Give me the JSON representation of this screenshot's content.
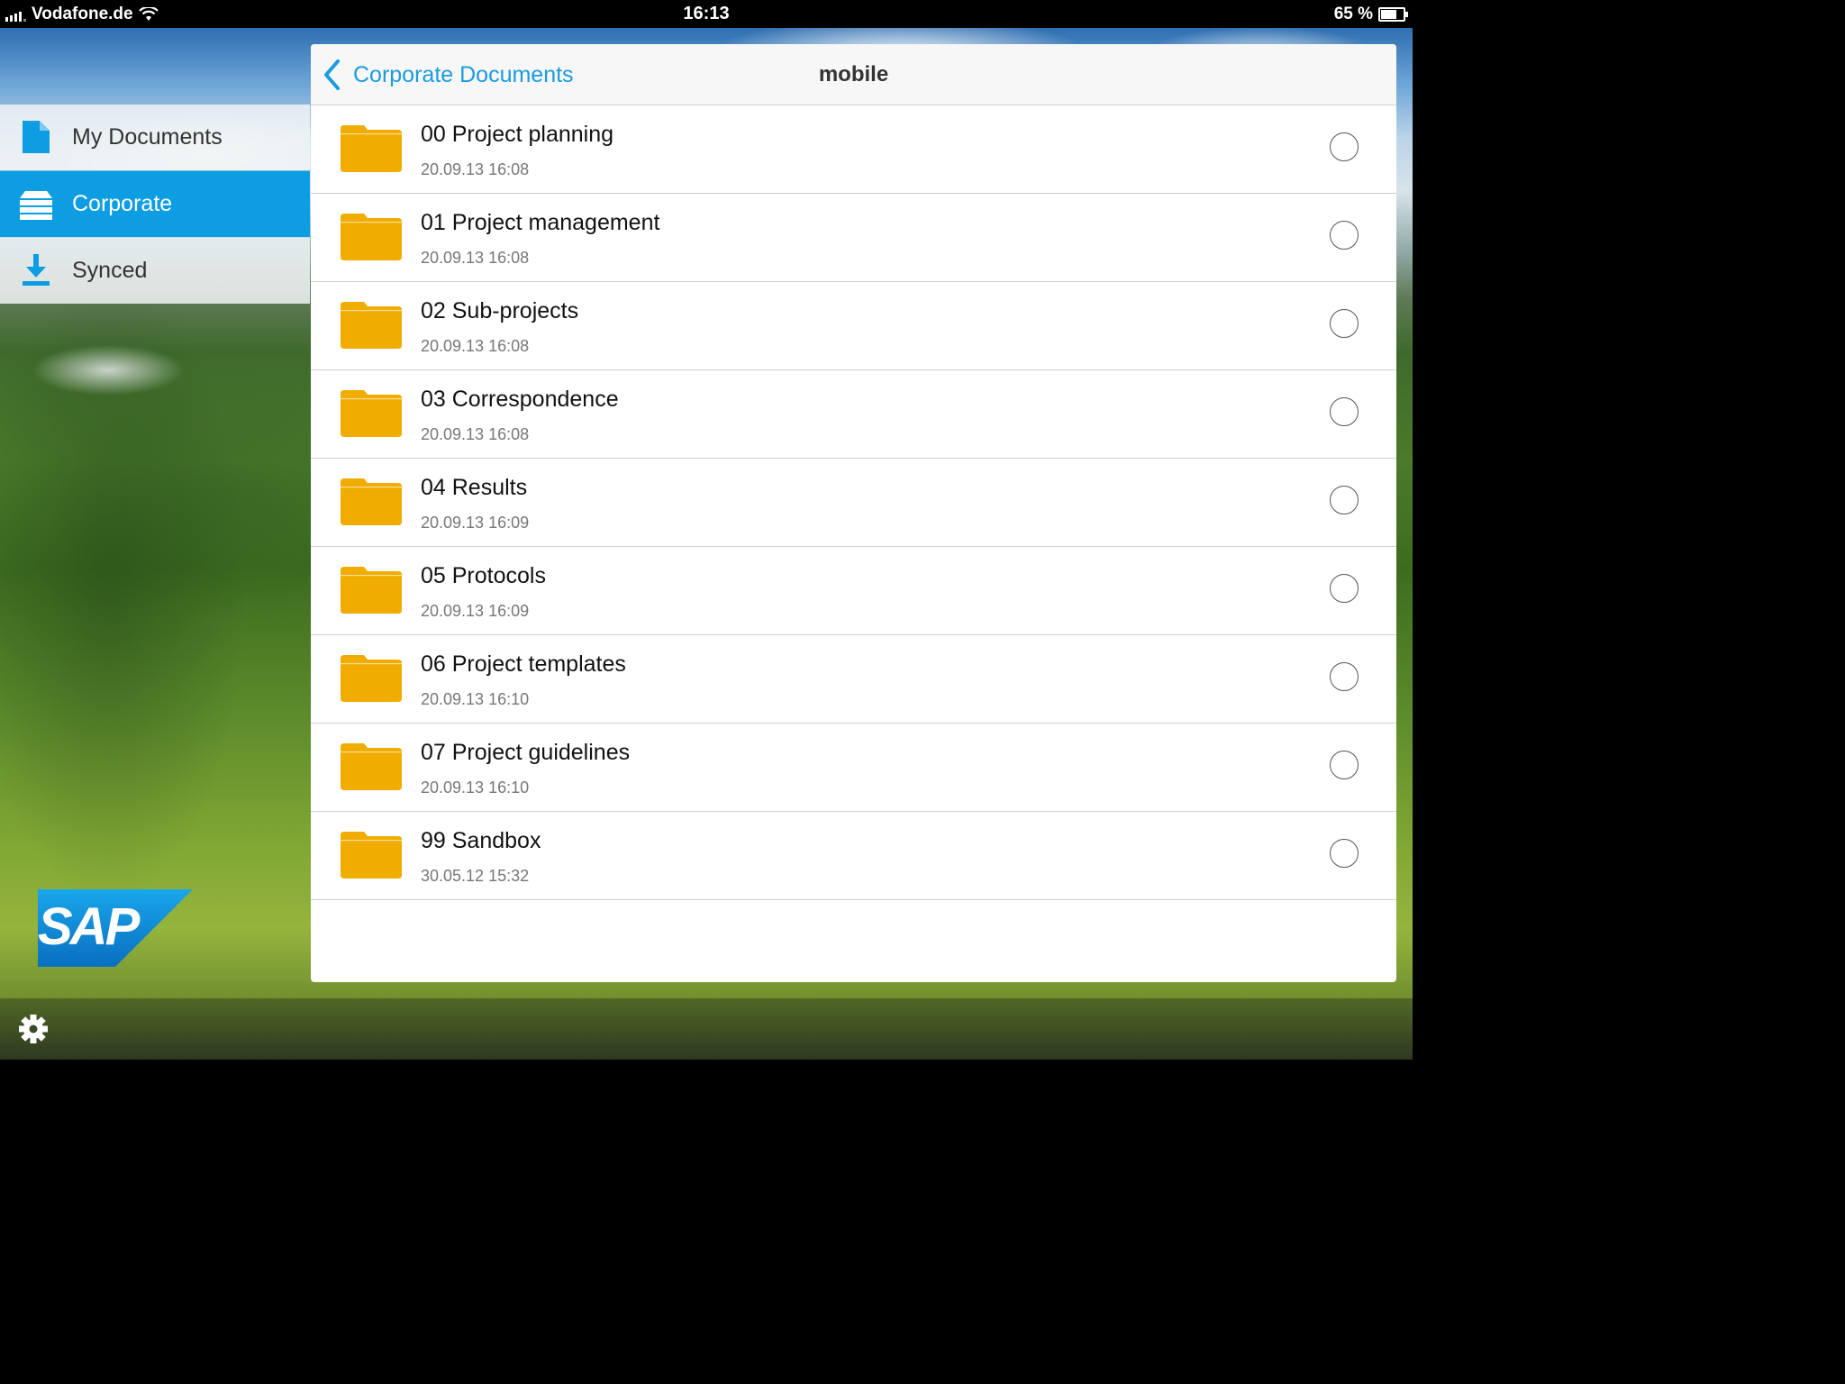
{
  "status_bar": {
    "carrier": "Vodafone.de",
    "time": "16:13",
    "battery": "65 %",
    "battery_level": 0.65
  },
  "sidebar": {
    "items": [
      {
        "label": "My Documents",
        "icon": "document-icon",
        "active": false
      },
      {
        "label": "Corporate",
        "icon": "server-stack-icon",
        "active": true
      },
      {
        "label": "Synced",
        "icon": "download-icon",
        "active": false
      }
    ]
  },
  "logo": {
    "text": "SAP"
  },
  "header": {
    "back_label": "Corporate Documents",
    "title": "mobile"
  },
  "files": [
    {
      "name": "00 Project planning",
      "date": "20.09.13 16:08"
    },
    {
      "name": "01 Project management",
      "date": "20.09.13 16:08"
    },
    {
      "name": "02 Sub-projects",
      "date": "20.09.13 16:08"
    },
    {
      "name": "03 Correspondence",
      "date": "20.09.13 16:08"
    },
    {
      "name": "04 Results",
      "date": "20.09.13 16:09"
    },
    {
      "name": "05 Protocols",
      "date": "20.09.13 16:09"
    },
    {
      "name": "06 Project templates",
      "date": "20.09.13 16:10"
    },
    {
      "name": "07 Project guidelines",
      "date": "20.09.13 16:10"
    },
    {
      "name": "99 Sandbox",
      "date": "30.05.12 15:32"
    }
  ],
  "colors": {
    "accent": "#0d9de3",
    "folder": "#f0ad00",
    "link": "#1a9be0"
  }
}
